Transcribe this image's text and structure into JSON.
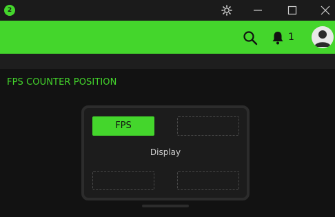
{
  "titlebar": {
    "badge_count": "2",
    "icons": [
      "settings-icon",
      "minimize-icon",
      "maximize-icon",
      "close-icon"
    ]
  },
  "header": {
    "notification_count": "1",
    "icons": [
      "search-icon",
      "bell-icon",
      "avatar-icon"
    ]
  },
  "section": {
    "title": "FPS COUNTER POSITION"
  },
  "monitor": {
    "display_label": "Display",
    "slots": [
      {
        "position": "top-left",
        "label": "FPS",
        "selected": true
      },
      {
        "position": "top-right",
        "label": "",
        "selected": false
      },
      {
        "position": "bottom-left",
        "label": "",
        "selected": false
      },
      {
        "position": "bottom-right",
        "label": "",
        "selected": false
      }
    ]
  },
  "colors": {
    "accent": "#44d62c",
    "background": "#121212",
    "titlebar": "#1b1b1b"
  }
}
